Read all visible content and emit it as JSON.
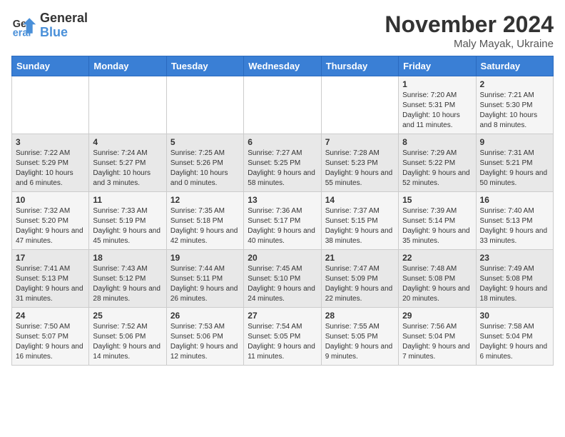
{
  "logo": {
    "line1": "General",
    "line2": "Blue"
  },
  "title": "November 2024",
  "location": "Maly Mayak, Ukraine",
  "weekdays": [
    "Sunday",
    "Monday",
    "Tuesday",
    "Wednesday",
    "Thursday",
    "Friday",
    "Saturday"
  ],
  "weeks": [
    [
      {
        "day": "",
        "info": ""
      },
      {
        "day": "",
        "info": ""
      },
      {
        "day": "",
        "info": ""
      },
      {
        "day": "",
        "info": ""
      },
      {
        "day": "",
        "info": ""
      },
      {
        "day": "1",
        "info": "Sunrise: 7:20 AM\nSunset: 5:31 PM\nDaylight: 10 hours and 11 minutes."
      },
      {
        "day": "2",
        "info": "Sunrise: 7:21 AM\nSunset: 5:30 PM\nDaylight: 10 hours and 8 minutes."
      }
    ],
    [
      {
        "day": "3",
        "info": "Sunrise: 7:22 AM\nSunset: 5:29 PM\nDaylight: 10 hours and 6 minutes."
      },
      {
        "day": "4",
        "info": "Sunrise: 7:24 AM\nSunset: 5:27 PM\nDaylight: 10 hours and 3 minutes."
      },
      {
        "day": "5",
        "info": "Sunrise: 7:25 AM\nSunset: 5:26 PM\nDaylight: 10 hours and 0 minutes."
      },
      {
        "day": "6",
        "info": "Sunrise: 7:27 AM\nSunset: 5:25 PM\nDaylight: 9 hours and 58 minutes."
      },
      {
        "day": "7",
        "info": "Sunrise: 7:28 AM\nSunset: 5:23 PM\nDaylight: 9 hours and 55 minutes."
      },
      {
        "day": "8",
        "info": "Sunrise: 7:29 AM\nSunset: 5:22 PM\nDaylight: 9 hours and 52 minutes."
      },
      {
        "day": "9",
        "info": "Sunrise: 7:31 AM\nSunset: 5:21 PM\nDaylight: 9 hours and 50 minutes."
      }
    ],
    [
      {
        "day": "10",
        "info": "Sunrise: 7:32 AM\nSunset: 5:20 PM\nDaylight: 9 hours and 47 minutes."
      },
      {
        "day": "11",
        "info": "Sunrise: 7:33 AM\nSunset: 5:19 PM\nDaylight: 9 hours and 45 minutes."
      },
      {
        "day": "12",
        "info": "Sunrise: 7:35 AM\nSunset: 5:18 PM\nDaylight: 9 hours and 42 minutes."
      },
      {
        "day": "13",
        "info": "Sunrise: 7:36 AM\nSunset: 5:17 PM\nDaylight: 9 hours and 40 minutes."
      },
      {
        "day": "14",
        "info": "Sunrise: 7:37 AM\nSunset: 5:15 PM\nDaylight: 9 hours and 38 minutes."
      },
      {
        "day": "15",
        "info": "Sunrise: 7:39 AM\nSunset: 5:14 PM\nDaylight: 9 hours and 35 minutes."
      },
      {
        "day": "16",
        "info": "Sunrise: 7:40 AM\nSunset: 5:13 PM\nDaylight: 9 hours and 33 minutes."
      }
    ],
    [
      {
        "day": "17",
        "info": "Sunrise: 7:41 AM\nSunset: 5:13 PM\nDaylight: 9 hours and 31 minutes."
      },
      {
        "day": "18",
        "info": "Sunrise: 7:43 AM\nSunset: 5:12 PM\nDaylight: 9 hours and 28 minutes."
      },
      {
        "day": "19",
        "info": "Sunrise: 7:44 AM\nSunset: 5:11 PM\nDaylight: 9 hours and 26 minutes."
      },
      {
        "day": "20",
        "info": "Sunrise: 7:45 AM\nSunset: 5:10 PM\nDaylight: 9 hours and 24 minutes."
      },
      {
        "day": "21",
        "info": "Sunrise: 7:47 AM\nSunset: 5:09 PM\nDaylight: 9 hours and 22 minutes."
      },
      {
        "day": "22",
        "info": "Sunrise: 7:48 AM\nSunset: 5:08 PM\nDaylight: 9 hours and 20 minutes."
      },
      {
        "day": "23",
        "info": "Sunrise: 7:49 AM\nSunset: 5:08 PM\nDaylight: 9 hours and 18 minutes."
      }
    ],
    [
      {
        "day": "24",
        "info": "Sunrise: 7:50 AM\nSunset: 5:07 PM\nDaylight: 9 hours and 16 minutes."
      },
      {
        "day": "25",
        "info": "Sunrise: 7:52 AM\nSunset: 5:06 PM\nDaylight: 9 hours and 14 minutes."
      },
      {
        "day": "26",
        "info": "Sunrise: 7:53 AM\nSunset: 5:06 PM\nDaylight: 9 hours and 12 minutes."
      },
      {
        "day": "27",
        "info": "Sunrise: 7:54 AM\nSunset: 5:05 PM\nDaylight: 9 hours and 11 minutes."
      },
      {
        "day": "28",
        "info": "Sunrise: 7:55 AM\nSunset: 5:05 PM\nDaylight: 9 hours and 9 minutes."
      },
      {
        "day": "29",
        "info": "Sunrise: 7:56 AM\nSunset: 5:04 PM\nDaylight: 9 hours and 7 minutes."
      },
      {
        "day": "30",
        "info": "Sunrise: 7:58 AM\nSunset: 5:04 PM\nDaylight: 9 hours and 6 minutes."
      }
    ]
  ]
}
